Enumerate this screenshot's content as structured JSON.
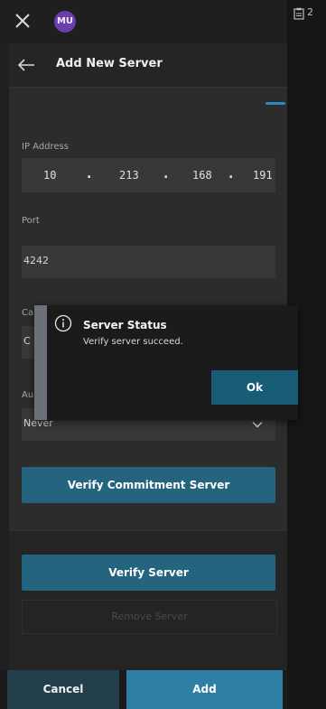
{
  "topbar": {
    "avatar_initials": "MU"
  },
  "side": {
    "text": "2"
  },
  "header": {
    "title": "Add New Server"
  },
  "form": {
    "ip_label": "IP Address",
    "ip_octets": [
      "10",
      "213",
      "168",
      "191"
    ],
    "port_label": "Port",
    "port_value": "4242",
    "cert_label_partial": "Ca",
    "cert_value_partial": "C",
    "auto_label_partial": "Au",
    "auto_value": "Never",
    "verify_commitment_label": "Verify Commitment Server"
  },
  "actions": {
    "verify_server_label": "Verify Server",
    "remove_server_label": "Remove Server",
    "cancel_label": "Cancel",
    "add_label": "Add"
  },
  "dialog": {
    "title": "Server Status",
    "message": "Verify server succeed.",
    "ok_label": "Ok"
  },
  "colors": {
    "accent": "#2b8ac0",
    "primary_button": "#24647f",
    "add_button": "#2f7fa4",
    "avatar": "#6b3fa8"
  },
  "icons": [
    "close-icon",
    "back-arrow-icon",
    "info-icon",
    "chevron-down-icon",
    "clipboard-icon"
  ]
}
